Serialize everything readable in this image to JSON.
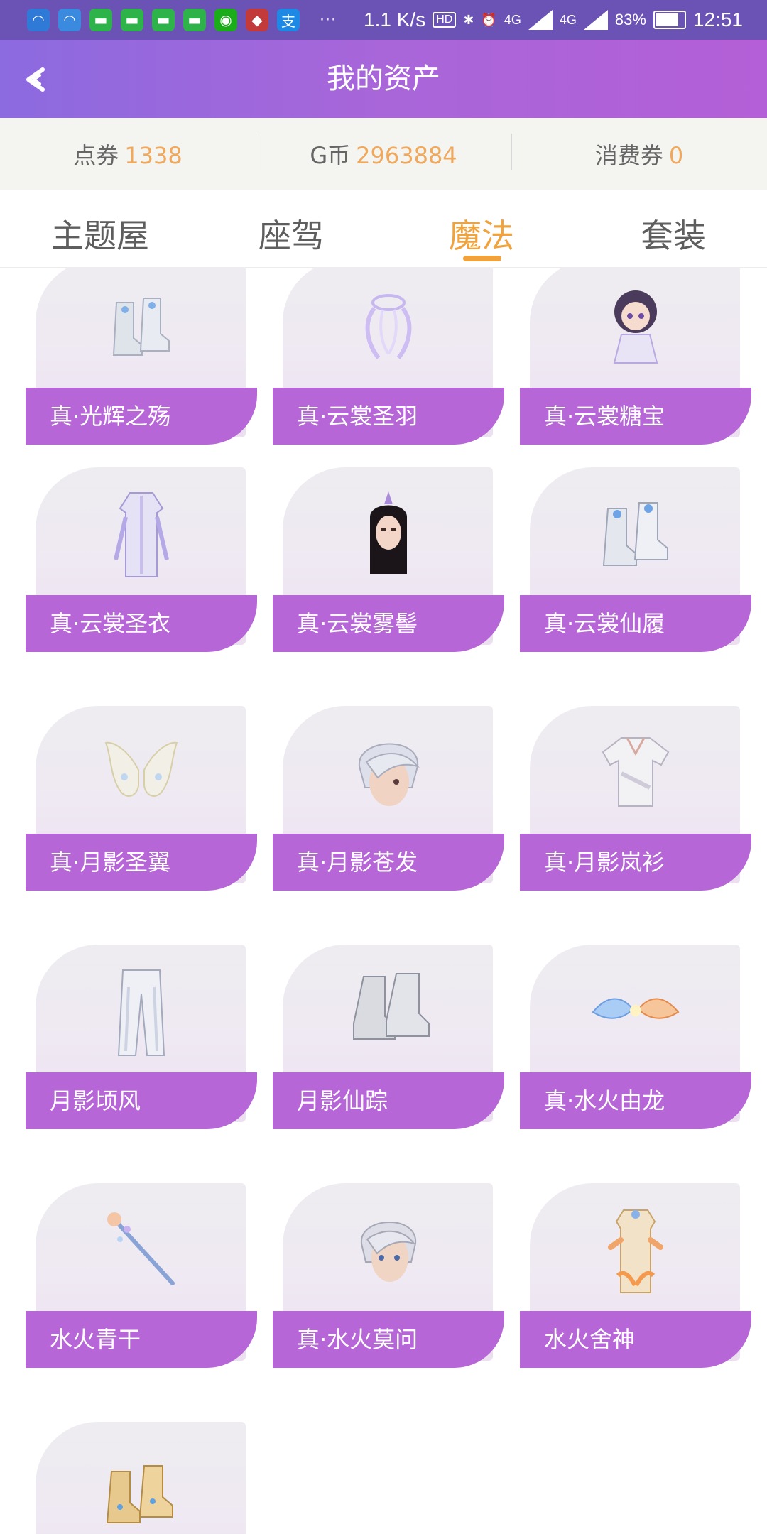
{
  "status_bar": {
    "net_speed": "1.1 K/s",
    "hd_badge": "HD",
    "signal_a": "4G",
    "signal_b": "4G",
    "battery": "83%",
    "time": "12:51"
  },
  "header": {
    "title": "我的资产"
  },
  "balance": {
    "items": [
      {
        "label": "点券",
        "value": "1338"
      },
      {
        "label": "G币",
        "value": "2963884"
      },
      {
        "label": "消费券",
        "value": "0"
      }
    ]
  },
  "tabs": [
    {
      "label": "主题屋"
    },
    {
      "label": "座驾"
    },
    {
      "label": "魔法"
    },
    {
      "label": "套装"
    }
  ],
  "items": [
    {
      "name": "真·光辉之殇",
      "icon": "silver-boots-icon"
    },
    {
      "name": "真·云裳圣羽",
      "icon": "wings-icon"
    },
    {
      "name": "真·云裳糖宝",
      "icon": "doll-icon"
    },
    {
      "name": "真·云裳圣衣",
      "icon": "robe-icon"
    },
    {
      "name": "真·云裳雾髻",
      "icon": "hair-icon"
    },
    {
      "name": "真·云裳仙履",
      "icon": "boots-icon"
    },
    {
      "name": "真·月影圣翼",
      "icon": "wings-icon"
    },
    {
      "name": "真·月影苍发",
      "icon": "hair-icon"
    },
    {
      "name": "真·月影岚衫",
      "icon": "shirt-icon"
    },
    {
      "name": "月影顷风",
      "icon": "pants-icon"
    },
    {
      "name": "月影仙踪",
      "icon": "boots-icon"
    },
    {
      "name": "真·水火由龙",
      "icon": "flame-icon"
    },
    {
      "name": "水火青干",
      "icon": "staff-icon"
    },
    {
      "name": "真·水火莫问",
      "icon": "hair-icon"
    },
    {
      "name": "水火舍神",
      "icon": "outfit-icon"
    },
    {
      "name": "",
      "icon": "golden-boots-icon"
    }
  ]
}
